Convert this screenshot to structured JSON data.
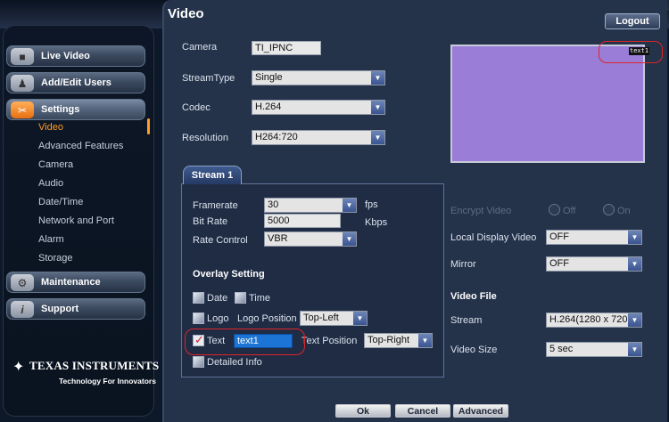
{
  "page_title": "Video",
  "logout_label": "Logout",
  "sidebar": {
    "live_video": "Live Video",
    "add_edit_users": "Add/Edit Users",
    "settings": "Settings",
    "settings_items": [
      "Video",
      "Advanced Features",
      "Camera",
      "Audio",
      "Date/Time",
      "Network and Port",
      "Alarm",
      "Storage"
    ],
    "maintenance": "Maintenance",
    "support": "Support",
    "brand": "TEXAS INSTRUMENTS",
    "tagline": "Technology For Innovators"
  },
  "form": {
    "camera_label": "Camera",
    "camera_value": "TI_IPNC",
    "streamtype_label": "StreamType",
    "streamtype_value": "Single",
    "codec_label": "Codec",
    "codec_value": "H.264",
    "resolution_label": "Resolution",
    "resolution_value": "H264:720"
  },
  "preview": {
    "osd_text": "text1"
  },
  "stream": {
    "tab_label": "Stream 1",
    "framerate_label": "Framerate",
    "framerate_value": "30",
    "framerate_unit": "fps",
    "bitrate_label": "Bit Rate",
    "bitrate_value": "5000",
    "bitrate_unit": "Kbps",
    "ratecontrol_label": "Rate Control",
    "ratecontrol_value": "VBR",
    "overlay_heading": "Overlay Setting",
    "date_label": "Date",
    "time_label": "Time",
    "logo_label": "Logo",
    "logo_position_label": "Logo Position",
    "logo_position_value": "Top-Left",
    "text_label": "Text",
    "text_value": "text1",
    "text_position_label": "Text Position",
    "text_position_value": "Top-Right",
    "detailed_info_label": "Detailed Info"
  },
  "right": {
    "encrypt_label": "Encrypt Video",
    "off_label": "Off",
    "on_label": "On",
    "local_display_label": "Local Display Video",
    "local_display_value": "OFF",
    "mirror_label": "Mirror",
    "mirror_value": "OFF",
    "video_file_heading": "Video File",
    "stream_label": "Stream",
    "stream_value": "H.264(1280 x 720)",
    "video_size_label": "Video Size",
    "video_size_value": "5 sec"
  },
  "buttons": {
    "ok": "Ok",
    "cancel": "Cancel",
    "advanced": "Advanced"
  },
  "colors": {
    "accent": "#ff9c2a",
    "highlight_ring": "#e0242a",
    "preview_bg": "#9a7dd6"
  },
  "icons": [
    "video-camera-icon",
    "add-user-icon",
    "settings-tools-icon",
    "maintenance-icon",
    "info-icon",
    "ti-logo-icon",
    "checkmark-icon",
    "dropdown-arrow-icon"
  ]
}
